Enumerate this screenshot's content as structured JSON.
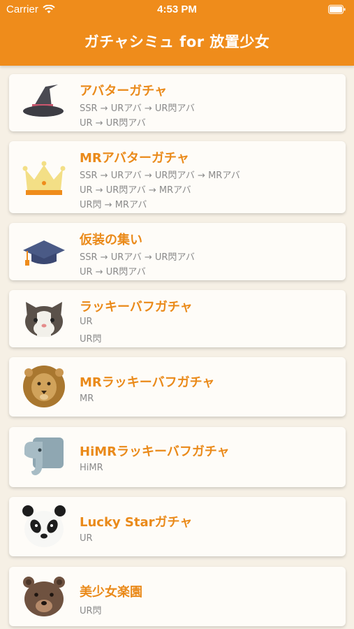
{
  "status_bar": {
    "carrier": "Carrier",
    "time": "4:53 PM"
  },
  "nav": {
    "title": "ガチャシミュ for 放置少女"
  },
  "gachas": [
    {
      "name": "アバターガチャ",
      "lines": [
        "SSR → URアバ → UR閃アバ",
        "UR → UR閃アバ"
      ],
      "icon": "witch-hat-icon"
    },
    {
      "name": "MRアバターガチャ",
      "lines": [
        "SSR → URアバ → UR閃アバ → MRアバ",
        "UR → UR閃アバ → MRアバ",
        "UR閃 → MRアバ"
      ],
      "icon": "crown-icon"
    },
    {
      "name": "仮装の集い",
      "lines": [
        "SSR → URアバ → UR閃アバ",
        "UR → UR閃アバ"
      ],
      "icon": "graduation-cap-icon"
    },
    {
      "name": "ラッキーバフガチャ",
      "lines": [
        "UR",
        "UR閃"
      ],
      "icon": "cat-icon"
    },
    {
      "name": "MRラッキーバフガチャ",
      "lines": [
        "MR"
      ],
      "icon": "lion-icon"
    },
    {
      "name": "HiMRラッキーバフガチャ",
      "lines": [
        "HiMR"
      ],
      "icon": "elephant-icon"
    },
    {
      "name": "Lucky Starガチャ",
      "lines": [
        "UR"
      ],
      "icon": "panda-icon"
    },
    {
      "name": "美少女楽園",
      "lines": [
        "UR閃"
      ],
      "icon": "bear-icon"
    }
  ],
  "colors": {
    "accent": "#ef8c1b",
    "title_text": "#ea8a1a",
    "sub_text": "#8a8a8a",
    "background": "#f6f0e5"
  }
}
